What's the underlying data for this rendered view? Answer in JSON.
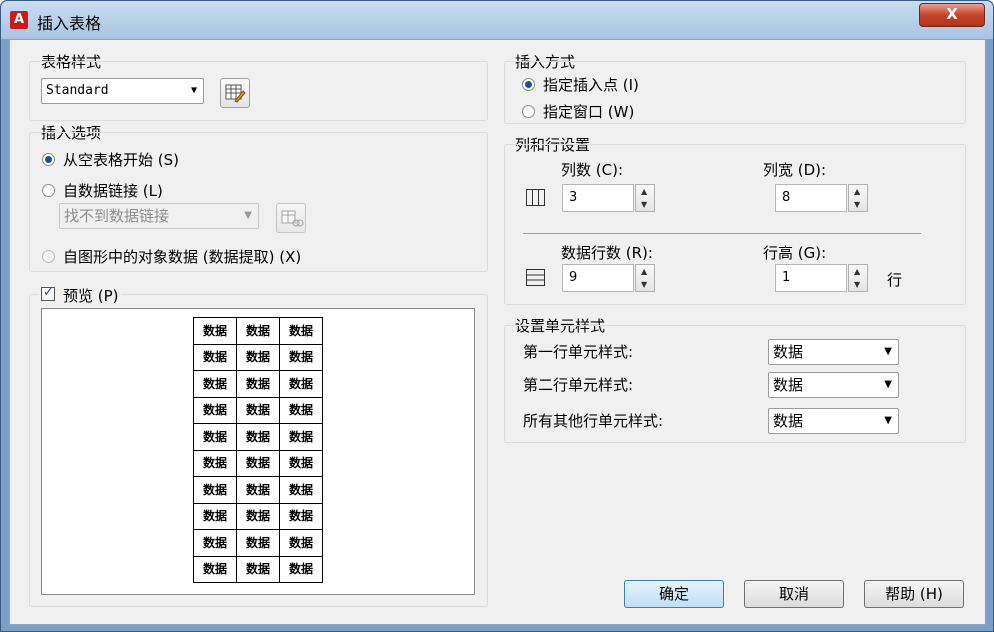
{
  "window": {
    "title": "插入表格",
    "close_label": "X"
  },
  "table_style": {
    "group_label": "表格样式",
    "combo_value": "Standard"
  },
  "insert_options": {
    "group_label": "插入选项",
    "from_empty": "从空表格开始 (S)",
    "from_data_link": "自数据链接 (L)",
    "data_link_value": "找不到数据链接",
    "from_drawing": "自图形中的对象数据 (数据提取) (X)"
  },
  "preview": {
    "checkbox_label": "预览 (P)",
    "rows": [
      [
        "数据",
        "数据",
        "数据"
      ],
      [
        "数据",
        "数据",
        "数据"
      ],
      [
        "数据",
        "数据",
        "数据"
      ],
      [
        "数据",
        "数据",
        "数据"
      ],
      [
        "数据",
        "数据",
        "数据"
      ],
      [
        "数据",
        "数据",
        "数据"
      ],
      [
        "数据",
        "数据",
        "数据"
      ],
      [
        "数据",
        "数据",
        "数据"
      ],
      [
        "数据",
        "数据",
        "数据"
      ],
      [
        "数据",
        "数据",
        "数据"
      ]
    ]
  },
  "insert_method": {
    "group_label": "插入方式",
    "insert_point": "指定插入点 (I)",
    "window": "指定窗口 (W)"
  },
  "column_row": {
    "group_label": "列和行设置",
    "columns_label": "列数 (C):",
    "columns_value": "3",
    "col_width_label": "列宽 (D):",
    "col_width_value": "8",
    "data_rows_label": "数据行数 (R):",
    "data_rows_value": "9",
    "row_height_label": "行高 (G):",
    "row_height_value": "1",
    "row_unit": "行"
  },
  "cell_styles": {
    "group_label": "设置单元样式",
    "first_row_label": "第一行单元样式:",
    "first_row_value": "数据",
    "second_row_label": "第二行单元样式:",
    "second_row_value": "数据",
    "other_rows_label": "所有其他行单元样式:",
    "other_rows_value": "数据"
  },
  "buttons": {
    "ok": "确定",
    "cancel": "取消",
    "help": "帮助 (H)"
  }
}
